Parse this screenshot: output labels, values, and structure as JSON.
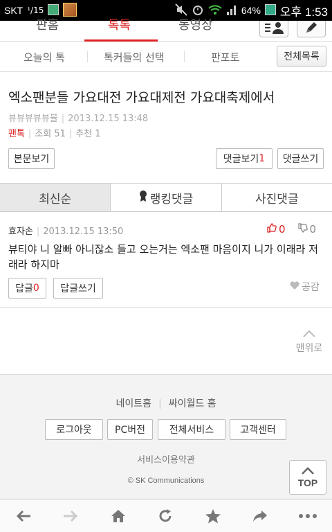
{
  "status_bar": {
    "carrier": "SKT",
    "date_badge": "¹/15",
    "battery": "64%",
    "time": "오후 1:53"
  },
  "top_nav": {
    "tabs": [
      {
        "label": "판홈",
        "active": false
      },
      {
        "label": "톡톡",
        "active": true
      },
      {
        "label": "동영상",
        "active": false
      }
    ],
    "icons": [
      "user-list-icon",
      "pencil-icon"
    ]
  },
  "sub_nav": {
    "items": [
      "오늘의 톡",
      "톡커들의 선택",
      "판포토"
    ],
    "all_list_button": "전체목록"
  },
  "post": {
    "title": "엑소팬분들 가요대전 가요대제전 가요대축제에서",
    "author": "뷰뷰뷰뷰뷰뷸",
    "datetime": "2013.12.15 13:48",
    "category": "팬톡",
    "views": "조회 51",
    "recommends": "추천 1",
    "view_body_button": "본문보기",
    "view_comments_label": "댓글보기",
    "comment_count": "1",
    "write_comment_button": "댓글쓰기"
  },
  "comment_tabs": [
    "최신순",
    "랭킹댓글",
    "사진댓글"
  ],
  "comment": {
    "author": "효자손",
    "datetime": "2013.12.15 13:50",
    "likes": "0",
    "dislikes": "0",
    "body": "뷰티야 니 알빠 아니잖소 들고 오는거는 엑소팬 마음이지 니가 이래라 저래라 하지마",
    "reply_label": "답글",
    "reply_count": "0",
    "write_reply_button": "답글쓰기",
    "empathy_label": "공감"
  },
  "scroll_top_link": "맨위로",
  "footer": {
    "links": [
      "네이트홈",
      "싸이월드 홈"
    ],
    "buttons": [
      "로그아웃",
      "PC버전",
      "전체서비스",
      "고객센터"
    ],
    "terms": "서비스이용약관",
    "copyright": "© SK Communications",
    "top_button": "TOP"
  },
  "colors": {
    "accent": "#dd2222",
    "footer_bg": "#f3f3f3"
  },
  "browser_bar": [
    "back-arrow-icon",
    "forward-arrow-icon",
    "home-icon",
    "refresh-icon",
    "bookmark-star-icon",
    "share-icon",
    "more-icon"
  ]
}
